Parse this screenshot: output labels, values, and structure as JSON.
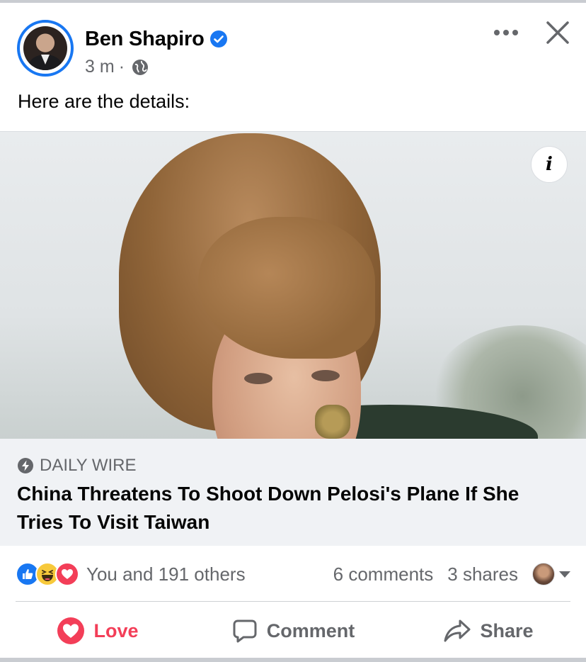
{
  "post": {
    "author": "Ben Shapiro",
    "time": "3 m",
    "separator": "·",
    "text": "Here are the details:"
  },
  "link": {
    "source": "DAILY WIRE",
    "headline": "China Threatens To Shoot Down Pelosi's Plane If She Tries To Visit Taiwan",
    "info_label": "i"
  },
  "engagement": {
    "reactions": [
      "like",
      "haha",
      "love"
    ],
    "reactors": "You and 191 others",
    "comments": "6 comments",
    "shares": "3 shares"
  },
  "actions": {
    "love": "Love",
    "comment": "Comment",
    "share": "Share"
  },
  "colors": {
    "brand_blue": "#1877f2",
    "love_red": "#f33e58",
    "secondary_text": "#65676b"
  },
  "icons": [
    "verified-icon",
    "globe-icon",
    "more-icon",
    "close-icon",
    "info-icon",
    "bolt-icon",
    "like-icon",
    "haha-icon",
    "love-icon",
    "comment-icon",
    "share-icon",
    "caret-down-icon"
  ]
}
